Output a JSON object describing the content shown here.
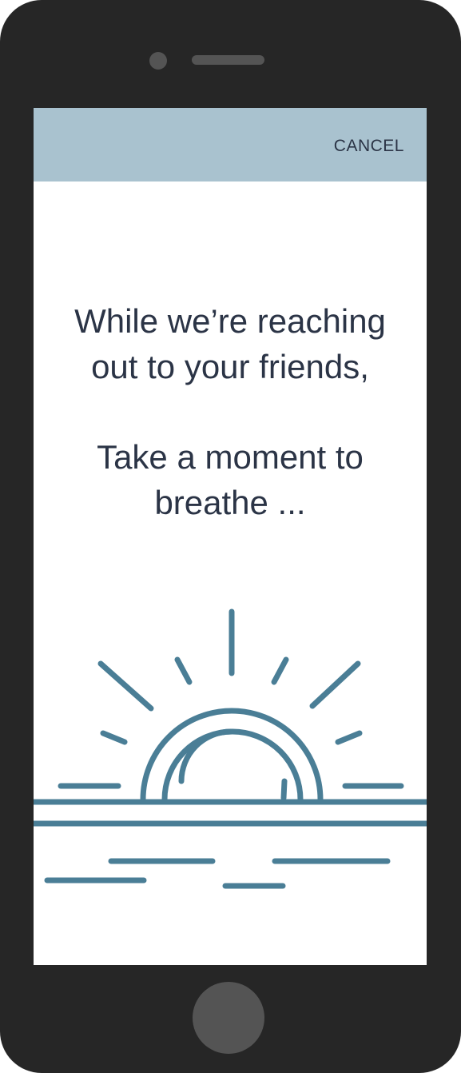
{
  "header": {
    "cancel_label": "CANCEL"
  },
  "message": {
    "line1": "While we’re reaching",
    "line2": "out to your friends,",
    "line3": "Take a moment to",
    "line4": "breathe ..."
  },
  "illustration": {
    "icon": "sunrise-icon",
    "color": "#4a7e96"
  },
  "colors": {
    "header_bg": "#a9c2cf",
    "text": "#2b3446",
    "frame": "#262626"
  }
}
